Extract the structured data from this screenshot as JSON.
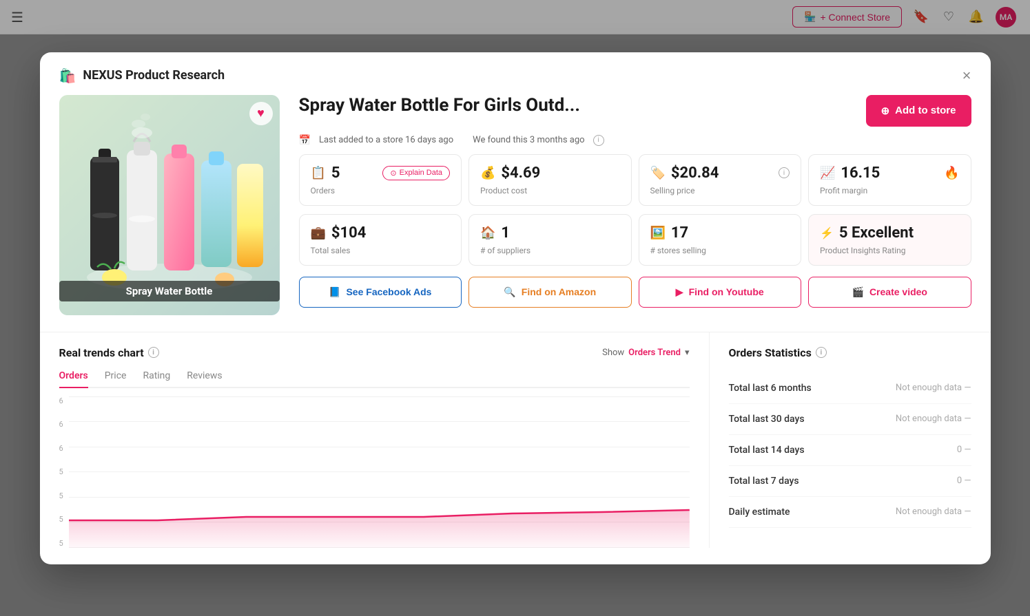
{
  "topbar": {
    "connect_store_label": "+ Connect Store",
    "avatar_initials": "MA"
  },
  "modal": {
    "title": "NEXUS Product Research",
    "close_label": "×",
    "product": {
      "title": "Spray Water Bottle For Girls Outd...",
      "image_label": "Spray Water Bottle",
      "last_added": "Last added to a store 16 days ago",
      "found_ago": "We found this 3 months ago",
      "add_to_store_label": "Add to store"
    },
    "stats": [
      {
        "icon": "📋",
        "icon_color": "pink",
        "value": "5",
        "label": "Orders",
        "has_explain": true,
        "explain_label": "Explain Data"
      },
      {
        "icon": "💰",
        "icon_color": "pink",
        "value": "$4.69",
        "label": "Product cost",
        "has_explain": false
      },
      {
        "icon": "🏷️",
        "icon_color": "pink",
        "value": "$20.84",
        "label": "Selling price",
        "has_explain": false,
        "has_info": true
      },
      {
        "icon": "📈",
        "icon_color": "pink",
        "value": "16.15",
        "label": "Profit margin",
        "has_fire": true
      },
      {
        "icon": "💼",
        "icon_color": "pink",
        "value": "$104",
        "label": "Total sales",
        "has_explain": false
      },
      {
        "icon": "🏠",
        "icon_color": "pink",
        "value": "1",
        "label": "# of suppliers",
        "has_explain": false
      },
      {
        "icon": "🖼️",
        "icon_color": "pink",
        "value": "17",
        "label": "# stores selling",
        "has_explain": false
      },
      {
        "icon": "⚡",
        "icon_color": "pink",
        "value": "5 Excellent",
        "label": "Product Insights Rating",
        "highlighted": true
      }
    ],
    "action_buttons": [
      {
        "label": "See Facebook Ads",
        "icon": "📘",
        "style": "blue"
      },
      {
        "label": "Find on Amazon",
        "icon": "🔍",
        "style": "orange"
      },
      {
        "label": "Find on Youtube",
        "icon": "▶️",
        "style": "red"
      },
      {
        "label": "Create video",
        "icon": "🎬",
        "style": "pink"
      }
    ],
    "chart": {
      "title": "Real trends chart",
      "show_label": "Show",
      "dropdown_value": "Orders Trend",
      "tabs": [
        "Orders",
        "Price",
        "Rating",
        "Reviews"
      ],
      "active_tab": "Orders",
      "y_axis": [
        "6",
        "6",
        "6",
        "5",
        "5",
        "5",
        "5"
      ],
      "chart_data": {
        "line_color": "#e91e63",
        "fill_color": "rgba(233, 30, 99, 0.15)"
      }
    },
    "orders_statistics": {
      "title": "Orders Statistics",
      "rows": [
        {
          "label": "Total last 6 months",
          "value": "Not enough data —"
        },
        {
          "label": "Total last 30 days",
          "value": "Not enough data —"
        },
        {
          "label": "Total last 14 days",
          "value": "0 —"
        },
        {
          "label": "Total last 7 days",
          "value": "0 —"
        },
        {
          "label": "Daily estimate",
          "value": "Not enough data —"
        }
      ]
    }
  }
}
